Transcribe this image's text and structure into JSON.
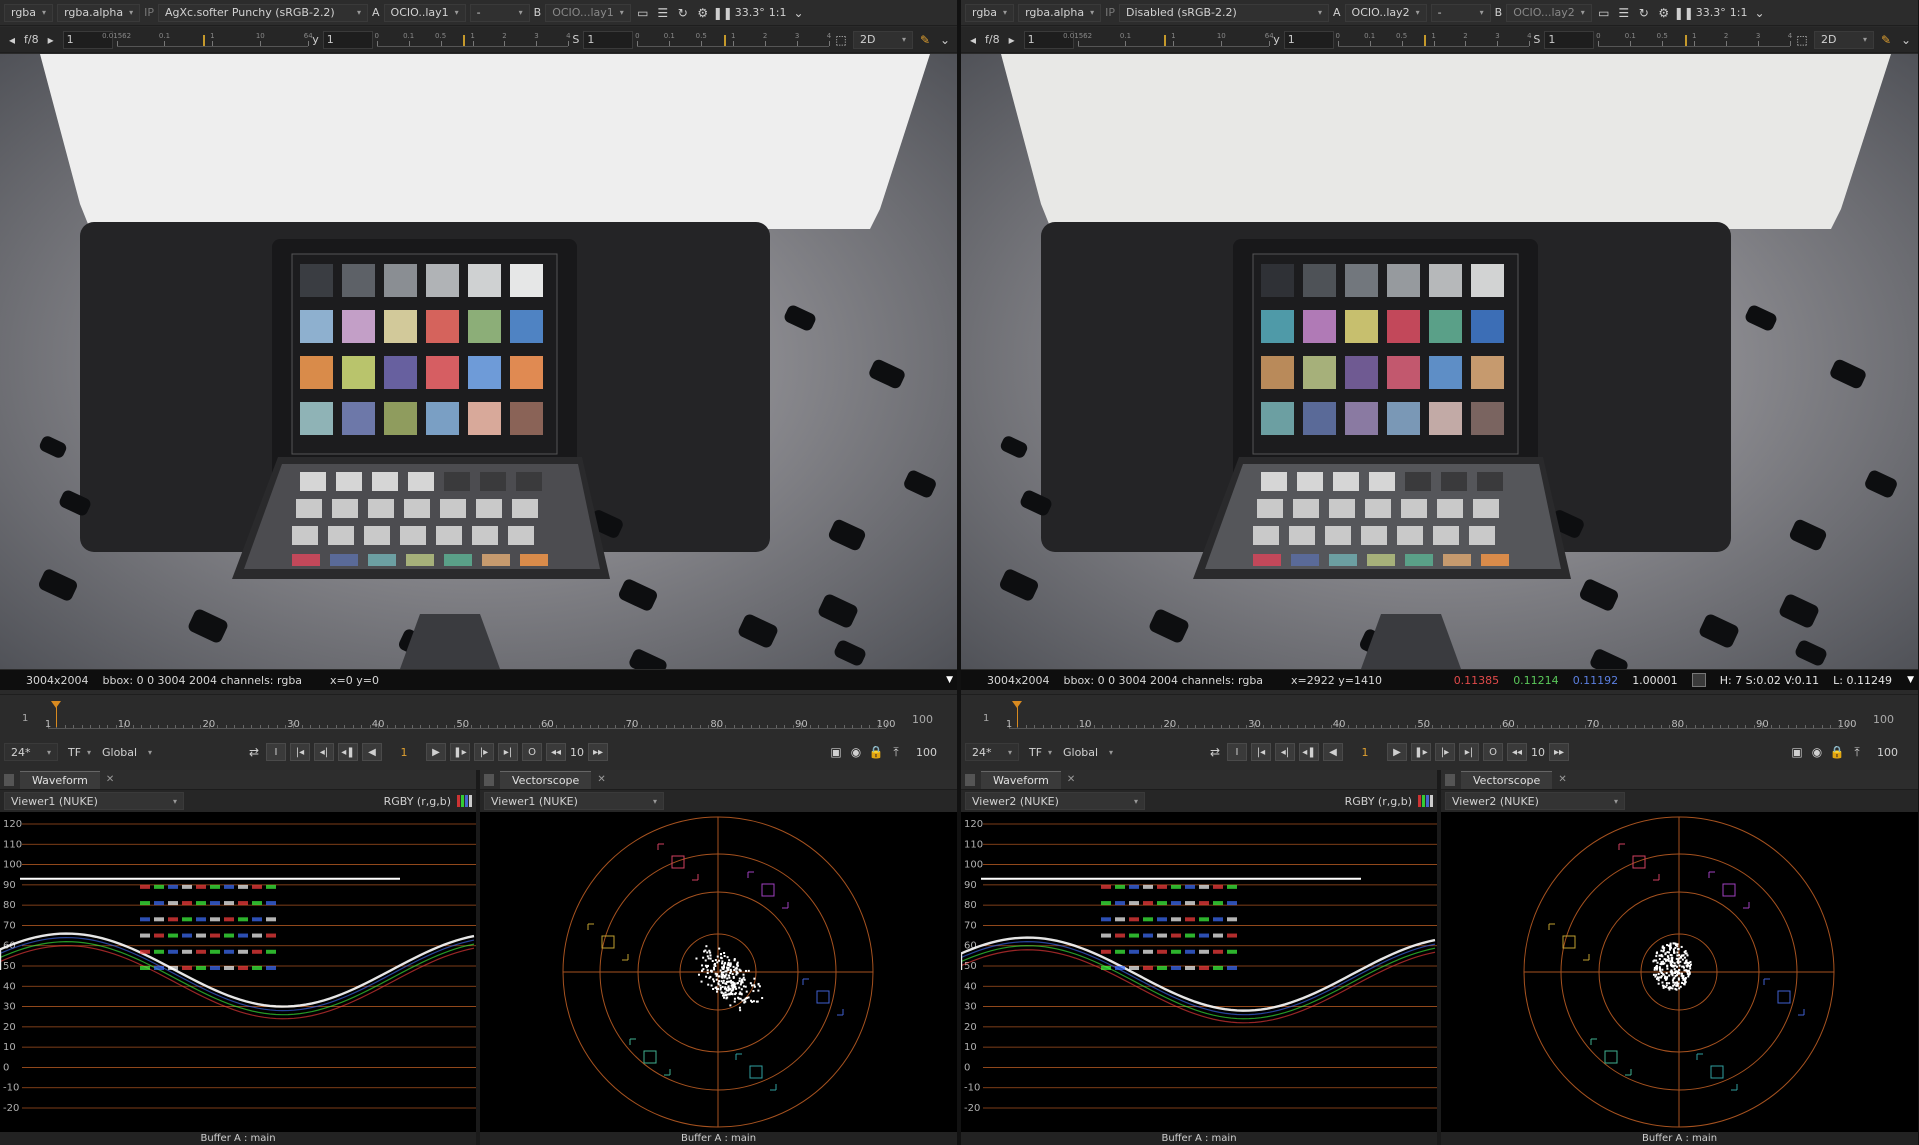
{
  "viewers": [
    {
      "id": "viewer1",
      "toolbar": {
        "channels": "rgba",
        "alpha": "rgba.alpha",
        "ip": "IP",
        "display_transform": "AgXc.softer Punchy (sRGB-2.2)",
        "input_a_label": "A",
        "input_a": "OCIO..lay1",
        "input_dash": "-",
        "input_b_label": "B",
        "input_b": "OCIO...lay1",
        "zoom": "33.3°",
        "ratio": "1:1"
      },
      "toolbar2": {
        "fstop": "f/8",
        "gain": "1",
        "gain_ticks": [
          "0.01562",
          "0.1",
          "1",
          "10",
          "64"
        ],
        "gamma_label": "y",
        "gamma": "1",
        "gamma_ticks": [
          "0",
          "0.1",
          "0.5",
          "1",
          "2",
          "3",
          "4"
        ],
        "sat_label": "S",
        "sat": "1",
        "sat_ticks": [
          "0",
          "0.1",
          "0.5",
          "1",
          "2",
          "3",
          "4"
        ],
        "mode": "2D"
      },
      "info": {
        "format": "3004x2004",
        "bbox": "bbox: 0 0 3004 2004 channels: rgba",
        "coords": "x=0 y=0",
        "r": "",
        "g": "",
        "b": "",
        "a": "",
        "hsv": "",
        "luma": ""
      },
      "timeline": {
        "start": "1",
        "end": "100",
        "ticks": [
          "1",
          "10",
          "20",
          "30",
          "40",
          "50",
          "60",
          "70",
          "80",
          "90",
          "100"
        ],
        "fps": "24*",
        "tf": "TF",
        "range": "Global",
        "frame": "1",
        "step": "10",
        "out": "100"
      },
      "waveform": {
        "tab": "Waveform",
        "source": "Viewer1 (NUKE)",
        "mode": "RGBY (r,g,b)",
        "scale": [
          "120",
          "110",
          "100",
          "90",
          "80",
          "70",
          "60",
          "50",
          "40",
          "30",
          "20",
          "10",
          "0",
          "-10",
          "-20"
        ],
        "footer": "Buffer A : main"
      },
      "vectorscope": {
        "tab": "Vectorscope",
        "source": "Viewer1 (NUKE)",
        "footer": "Buffer A : main"
      }
    },
    {
      "id": "viewer2",
      "toolbar": {
        "channels": "rgba",
        "alpha": "rgba.alpha",
        "ip": "IP",
        "display_transform": "Disabled (sRGB-2.2)",
        "input_a_label": "A",
        "input_a": "OCIO..lay2",
        "input_dash": "-",
        "input_b_label": "B",
        "input_b": "OCIO...lay2",
        "zoom": "33.3°",
        "ratio": "1:1"
      },
      "toolbar2": {
        "fstop": "f/8",
        "gain": "1",
        "gain_ticks": [
          "0.01562",
          "0.1",
          "1",
          "10",
          "64"
        ],
        "gamma_label": "y",
        "gamma": "1",
        "gamma_ticks": [
          "0",
          "0.1",
          "0.5",
          "1",
          "2",
          "3",
          "4"
        ],
        "sat_label": "S",
        "sat": "1",
        "sat_ticks": [
          "0",
          "0.1",
          "0.5",
          "1",
          "2",
          "3",
          "4"
        ],
        "mode": "2D"
      },
      "info": {
        "format": "3004x2004",
        "bbox": "bbox: 0 0 3004 2004 channels: rgba",
        "coords": "x=2922 y=1410",
        "r": "0.11385",
        "g": "0.11214",
        "b": "0.11192",
        "a": "1.00001",
        "hsv": "H:  7 S:0.02 V:0.11",
        "luma": "L: 0.11249"
      },
      "timeline": {
        "start": "1",
        "end": "100",
        "ticks": [
          "1",
          "10",
          "20",
          "30",
          "40",
          "50",
          "60",
          "70",
          "80",
          "90",
          "100"
        ],
        "fps": "24*",
        "tf": "TF",
        "range": "Global",
        "frame": "1",
        "step": "10",
        "out": "100"
      },
      "waveform": {
        "tab": "Waveform",
        "source": "Viewer2 (NUKE)",
        "mode": "RGBY (r,g,b)",
        "scale": [
          "120",
          "110",
          "100",
          "90",
          "80",
          "70",
          "60",
          "50",
          "40",
          "30",
          "20",
          "10",
          "0",
          "-10",
          "-20"
        ],
        "footer": "Buffer A : main"
      },
      "vectorscope": {
        "tab": "Vectorscope",
        "source": "Viewer2 (NUKE)",
        "footer": "Buffer A : main"
      }
    }
  ],
  "colors": {
    "accent": "#d88a20",
    "graticule": "#a6521f",
    "red_value": "#e04a4a",
    "green_value": "#5ac85a",
    "blue_value": "#5b7fe0"
  }
}
